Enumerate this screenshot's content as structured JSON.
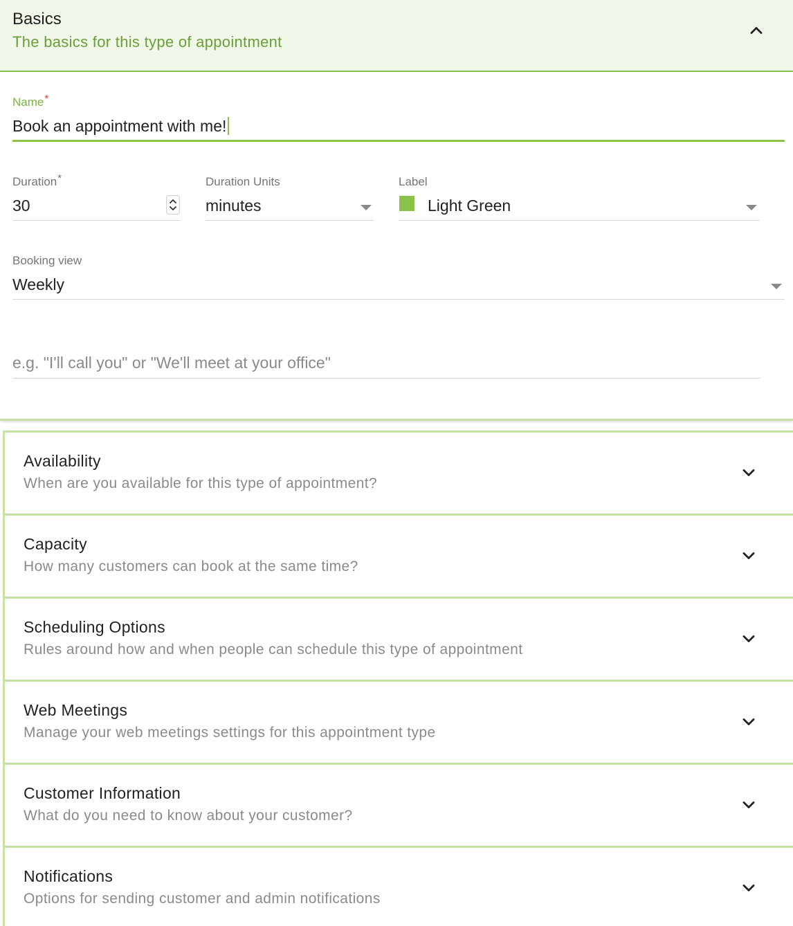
{
  "basics": {
    "title": "Basics",
    "subtitle": "The basics for this type of appointment",
    "name": {
      "label": "Name",
      "required": "*",
      "value": "Book an appointment with me!"
    },
    "duration": {
      "label": "Duration",
      "required": "*",
      "value": "30"
    },
    "duration_units": {
      "label": "Duration Units",
      "value": "minutes"
    },
    "label_field": {
      "label": "Label",
      "value": "Light Green",
      "color": "#8bc34a"
    },
    "booking_view": {
      "label": "Booking view",
      "value": "Weekly"
    },
    "location": {
      "placeholder": "e.g. \"I'll call you\" or \"We'll meet at your office\""
    }
  },
  "panels": [
    {
      "title": "Availability",
      "subtitle": "When are you available for this type of appointment?"
    },
    {
      "title": "Capacity",
      "subtitle": "How many customers can book at the same time?"
    },
    {
      "title": "Scheduling Options",
      "subtitle": "Rules around how and when people can schedule this type of appointment"
    },
    {
      "title": "Web Meetings",
      "subtitle": "Manage your web meetings settings for this appointment type"
    },
    {
      "title": "Customer Information",
      "subtitle": "What do you need to know about your customer?"
    },
    {
      "title": "Notifications",
      "subtitle": "Options for sending customer and admin notifications"
    }
  ],
  "colors": {
    "accent": "#8bc34a",
    "accent_dark": "#689f38",
    "header_bg": "#f1f8e9"
  },
  "icons": {
    "collapse": "chevron-up-icon",
    "expand": "chevron-down-icon",
    "dropdown": "caret-down-icon",
    "stepper": "stepper-arrows-icon"
  }
}
